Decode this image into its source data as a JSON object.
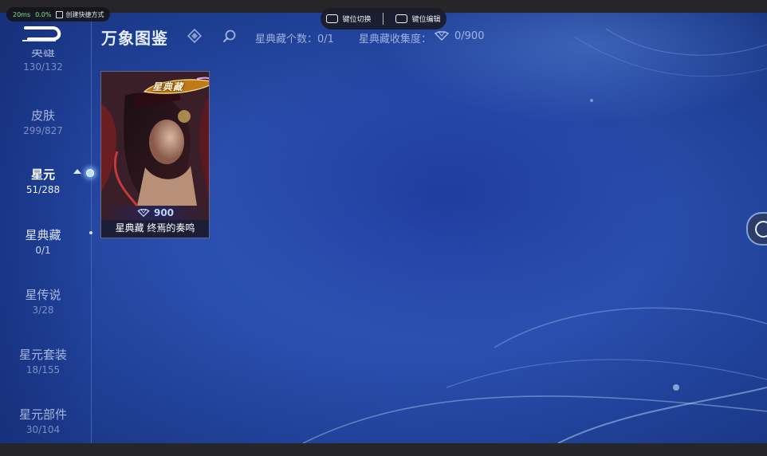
{
  "overlay": {
    "latency": "20ms",
    "loss": "0.0%",
    "shortcut_label": "创建快捷方式",
    "key_switch": "键位切换",
    "key_edit": "键位编辑"
  },
  "header": {
    "title": "万象图鉴",
    "collection_count_label": "星典藏个数：0/1",
    "collection_progress_label": "星典藏收集度：",
    "collection_progress_value": "0/900"
  },
  "sidebar": {
    "items": [
      {
        "label": "英雄",
        "count": "130/132"
      },
      {
        "label": "皮肤",
        "count": "299/827"
      },
      {
        "label": "星元",
        "count": "51/288"
      },
      {
        "label": "星典藏",
        "count": "0/1"
      },
      {
        "label": "星传说",
        "count": "3/28"
      },
      {
        "label": "星元套装",
        "count": "18/155"
      },
      {
        "label": "星元部件",
        "count": "30/104"
      }
    ],
    "active_index": 2
  },
  "card": {
    "badge": "星典藏",
    "price": "900",
    "name": "星典藏  终焉的奏鸣"
  },
  "colors": {
    "background": "#2a4fae",
    "accent": "#bcd6ff",
    "status_green": "#7de37d"
  }
}
